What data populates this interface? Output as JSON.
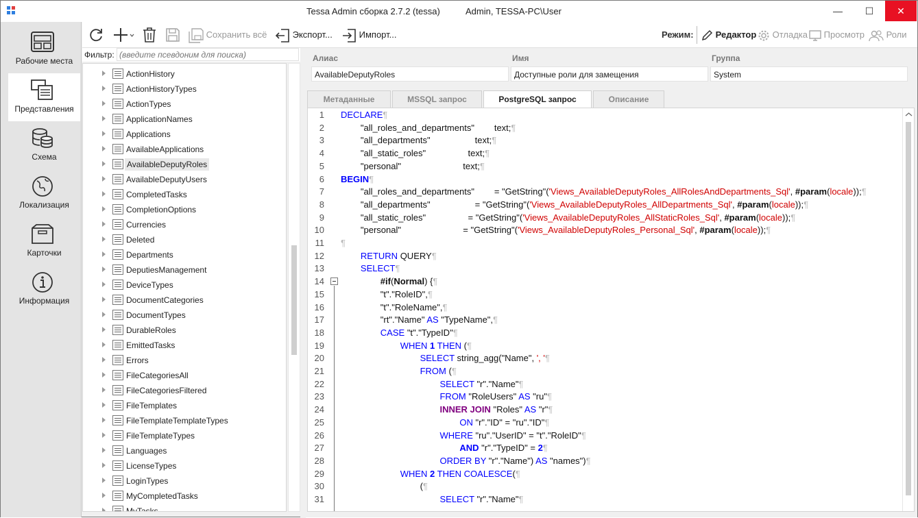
{
  "window": {
    "title": "Tessa Admin сборка 2.7.2 (tessa)",
    "user": "Admin, TESSA-PC\\User"
  },
  "nav": [
    {
      "label": "Рабочие места",
      "icon": "workplaces-icon"
    },
    {
      "label": "Представления",
      "icon": "views-icon"
    },
    {
      "label": "Схема",
      "icon": "database-icon"
    },
    {
      "label": "Локализация",
      "icon": "globe-icon"
    },
    {
      "label": "Карточки",
      "icon": "box-icon"
    },
    {
      "label": "Информация",
      "icon": "info-icon"
    }
  ],
  "toolbar": {
    "save_all": "Сохранить всё",
    "export": "Экспорт...",
    "import": "Импорт...",
    "mode_label": "Режим:",
    "modes": {
      "editor": "Редактор",
      "debug": "Отладка",
      "preview": "Просмотр",
      "roles": "Роли"
    }
  },
  "filter": {
    "label": "Фильтр:",
    "placeholder": "(введите псевдоним для поиска)"
  },
  "tree": {
    "items": [
      "ActionHistory",
      "ActionHistoryTypes",
      "ActionTypes",
      "ApplicationNames",
      "Applications",
      "AvailableApplications",
      "AvailableDeputyRoles",
      "AvailableDeputyUsers",
      "CompletedTasks",
      "CompletionOptions",
      "Currencies",
      "Deleted",
      "Departments",
      "DeputiesManagement",
      "DeviceTypes",
      "DocumentCategories",
      "DocumentTypes",
      "DurableRoles",
      "EmittedTasks",
      "Errors",
      "FileCategoriesAll",
      "FileCategoriesFiltered",
      "FileTemplates",
      "FileTemplateTemplateTypes",
      "FileTemplateTypes",
      "Languages",
      "LicenseTypes",
      "LoginTypes",
      "MyCompletedTasks",
      "MyTasks"
    ],
    "selected": "AvailableDeputyRoles"
  },
  "fields": {
    "alias_label": "Алиас",
    "alias_value": "AvailableDeputyRoles",
    "name_label": "Имя",
    "name_value": "Доступные роли для замещения",
    "group_label": "Группа",
    "group_value": "System"
  },
  "tabs": [
    "Метаданные",
    "MSSQL запрос",
    "PostgreSQL запрос",
    "Описание"
  ],
  "active_tab": "PostgreSQL запрос",
  "code": {
    "line_numbers": [
      "1",
      "2",
      "3",
      "4",
      "5",
      "6",
      "7",
      "8",
      "9",
      "10",
      "11",
      "12",
      "13",
      "14",
      "15",
      "16",
      "17",
      "18",
      "19",
      "20",
      "21",
      "22",
      "23",
      "24",
      "25",
      "26",
      "27",
      "28",
      "29",
      "30",
      "31"
    ],
    "lines": [
      [
        [
          "kw",
          "DECLARE"
        ],
        [
          "pil",
          "¶"
        ]
      ],
      [
        [
          "",
          "        \"all_roles_and_departments\"        text;"
        ],
        [
          "pil",
          "¶"
        ]
      ],
      [
        [
          "",
          "        \"all_departments\"                  text;"
        ],
        [
          "pil",
          "¶"
        ]
      ],
      [
        [
          "",
          "        \"all_static_roles\"                 text;"
        ],
        [
          "pil",
          "¶"
        ]
      ],
      [
        [
          "",
          "        \"personal\"                         text;"
        ],
        [
          "pil",
          "¶"
        ]
      ],
      [
        [
          "kwb",
          "BEGIN"
        ],
        [
          "pil",
          "¶"
        ]
      ],
      [
        [
          "",
          "        \"all_roles_and_departments\"        = \"GetString\"("
        ],
        [
          "str",
          "'Views_AvailableDeputyRoles_AllRolesAndDepartments_Sql'"
        ],
        [
          "",
          ", "
        ],
        [
          "bold",
          "#param"
        ],
        [
          "",
          "("
        ],
        [
          "str",
          "locale"
        ],
        [
          "",
          "));"
        ],
        [
          "pil",
          "¶"
        ]
      ],
      [
        [
          "",
          "        \"all_departments\"                  = \"GetString\"("
        ],
        [
          "str",
          "'Views_AvailableDeputyRoles_AllDepartments_Sql'"
        ],
        [
          "",
          ", "
        ],
        [
          "bold",
          "#param"
        ],
        [
          "",
          "("
        ],
        [
          "str",
          "locale"
        ],
        [
          "",
          "));"
        ],
        [
          "pil",
          "¶"
        ]
      ],
      [
        [
          "",
          "        \"all_static_roles\"                 = \"GetString\"("
        ],
        [
          "str",
          "'Views_AvailableDeputyRoles_AllStaticRoles_Sql'"
        ],
        [
          "",
          ", "
        ],
        [
          "bold",
          "#param"
        ],
        [
          "",
          "("
        ],
        [
          "str",
          "locale"
        ],
        [
          "",
          "));"
        ],
        [
          "pil",
          "¶"
        ]
      ],
      [
        [
          "",
          "        \"personal\"                         = \"GetString\"("
        ],
        [
          "str",
          "'Views_AvailableDeputyRoles_Personal_Sql'"
        ],
        [
          "",
          ", "
        ],
        [
          "bold",
          "#param"
        ],
        [
          "",
          "("
        ],
        [
          "str",
          "locale"
        ],
        [
          "",
          "));"
        ],
        [
          "pil",
          "¶"
        ]
      ],
      [
        [
          "pil",
          "¶"
        ]
      ],
      [
        [
          "",
          "        "
        ],
        [
          "kw",
          "RETURN"
        ],
        [
          "",
          " QUERY"
        ],
        [
          "pil",
          "¶"
        ]
      ],
      [
        [
          "",
          "        "
        ],
        [
          "kw",
          "SELECT"
        ],
        [
          "pil",
          "¶"
        ]
      ],
      [
        [
          "",
          "                "
        ],
        [
          "bold",
          "#if"
        ],
        [
          "",
          "("
        ],
        [
          "bold",
          "Normal"
        ],
        [
          "",
          ") {"
        ],
        [
          "pil",
          "¶"
        ]
      ],
      [
        [
          "",
          "                \"t\".\"RoleID\","
        ],
        [
          "pil",
          "¶"
        ]
      ],
      [
        [
          "",
          "                \"t\".\"RoleName\","
        ],
        [
          "pil",
          "¶"
        ]
      ],
      [
        [
          "",
          "                \"rt\".\"Name\" "
        ],
        [
          "kw",
          "AS"
        ],
        [
          "",
          " \"TypeName\","
        ],
        [
          "pil",
          "¶"
        ]
      ],
      [
        [
          "",
          "                "
        ],
        [
          "kw",
          "CASE"
        ],
        [
          "",
          " \"t\".\"TypeID\""
        ],
        [
          "pil",
          "¶"
        ]
      ],
      [
        [
          "",
          "                        "
        ],
        [
          "kw",
          "WHEN"
        ],
        [
          "",
          " "
        ],
        [
          "kwb",
          "1"
        ],
        [
          "",
          " "
        ],
        [
          "kw",
          "THEN"
        ],
        [
          "",
          " ("
        ],
        [
          "pil",
          "¶"
        ]
      ],
      [
        [
          "",
          "                                "
        ],
        [
          "kw",
          "SELECT"
        ],
        [
          "",
          " string_agg(\"Name\", "
        ],
        [
          "str",
          "', '"
        ],
        [
          ")"
        ],
        [
          "pil",
          "¶"
        ]
      ],
      [
        [
          "",
          "                                "
        ],
        [
          "kw",
          "FROM"
        ],
        [
          "",
          " ("
        ],
        [
          "pil",
          "¶"
        ]
      ],
      [
        [
          "",
          "                                        "
        ],
        [
          "kw",
          "SELECT"
        ],
        [
          "",
          " \"r\".\"Name\""
        ],
        [
          "pil",
          "¶"
        ]
      ],
      [
        [
          "",
          "                                        "
        ],
        [
          "kw",
          "FROM"
        ],
        [
          "",
          " \"RoleUsers\" "
        ],
        [
          "kw",
          "AS"
        ],
        [
          "",
          " \"ru\""
        ],
        [
          "pil",
          "¶"
        ]
      ],
      [
        [
          "",
          "                                        "
        ],
        [
          "kwp",
          "INNER JOIN"
        ],
        [
          "",
          " \"Roles\" "
        ],
        [
          "kw",
          "AS"
        ],
        [
          "",
          " \"r\""
        ],
        [
          "pil",
          "¶"
        ]
      ],
      [
        [
          "",
          "                                                "
        ],
        [
          "kw",
          "ON"
        ],
        [
          "",
          " \"r\".\"ID\" = \"ru\".\"ID\""
        ],
        [
          "pil",
          "¶"
        ]
      ],
      [
        [
          "",
          "                                        "
        ],
        [
          "kw",
          "WHERE"
        ],
        [
          "",
          " \"ru\".\"UserID\" = \"t\".\"RoleID\""
        ],
        [
          "pil",
          "¶"
        ]
      ],
      [
        [
          "",
          "                                                "
        ],
        [
          "kwb",
          "AND"
        ],
        [
          "",
          " \"r\".\"TypeID\" = "
        ],
        [
          "kwb",
          "2"
        ],
        [
          "pil",
          "¶"
        ]
      ],
      [
        [
          "",
          "                                        "
        ],
        [
          "kw",
          "ORDER BY"
        ],
        [
          "",
          " \"r\".\"Name\") "
        ],
        [
          "kw",
          "AS"
        ],
        [
          "",
          " \"names\")"
        ],
        [
          "pil",
          "¶"
        ]
      ],
      [
        [
          "",
          "                        "
        ],
        [
          "kw",
          "WHEN"
        ],
        [
          "",
          " "
        ],
        [
          "kwb",
          "2"
        ],
        [
          "",
          " "
        ],
        [
          "kw",
          "THEN"
        ],
        [
          "",
          " "
        ],
        [
          "kw",
          "COALESCE"
        ],
        [
          "",
          "("
        ],
        [
          "pil",
          "¶"
        ]
      ],
      [
        [
          "",
          "                                ("
        ],
        [
          "pil",
          "¶"
        ]
      ],
      [
        [
          "",
          "                                        "
        ],
        [
          "kw",
          "SELECT"
        ],
        [
          "",
          " \"r\".\"Name\""
        ],
        [
          "pil",
          "¶"
        ]
      ]
    ]
  }
}
